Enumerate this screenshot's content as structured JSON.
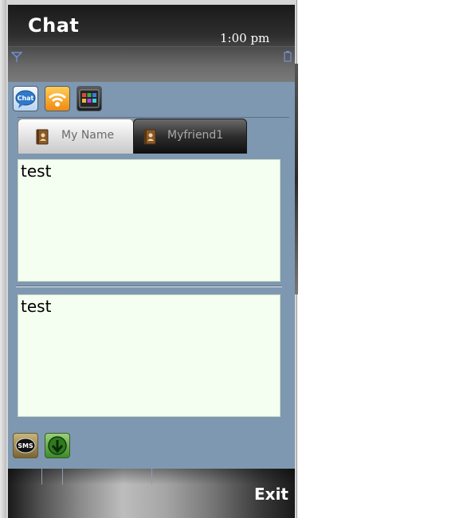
{
  "header": {
    "title": "Chat",
    "time": "1:00 pm"
  },
  "toolbar": {
    "chat_icon_label": "Chat",
    "icons": [
      "chat-icon",
      "rss-icon",
      "apps-icon"
    ]
  },
  "tabs": [
    {
      "label": "My Name",
      "active": true
    },
    {
      "label": "Myfriend1",
      "active": false
    }
  ],
  "messages": {
    "received_text": "test",
    "compose_text": "test"
  },
  "bottom_actions": {
    "sms_label": "SMS",
    "icons": [
      "sms-icon",
      "download-icon"
    ]
  },
  "softkeys": {
    "right": "Exit"
  },
  "colors": {
    "screen_bg": "#7f98b1",
    "message_bg": "#f5fff1",
    "header_bg": "#1a1a1a"
  }
}
